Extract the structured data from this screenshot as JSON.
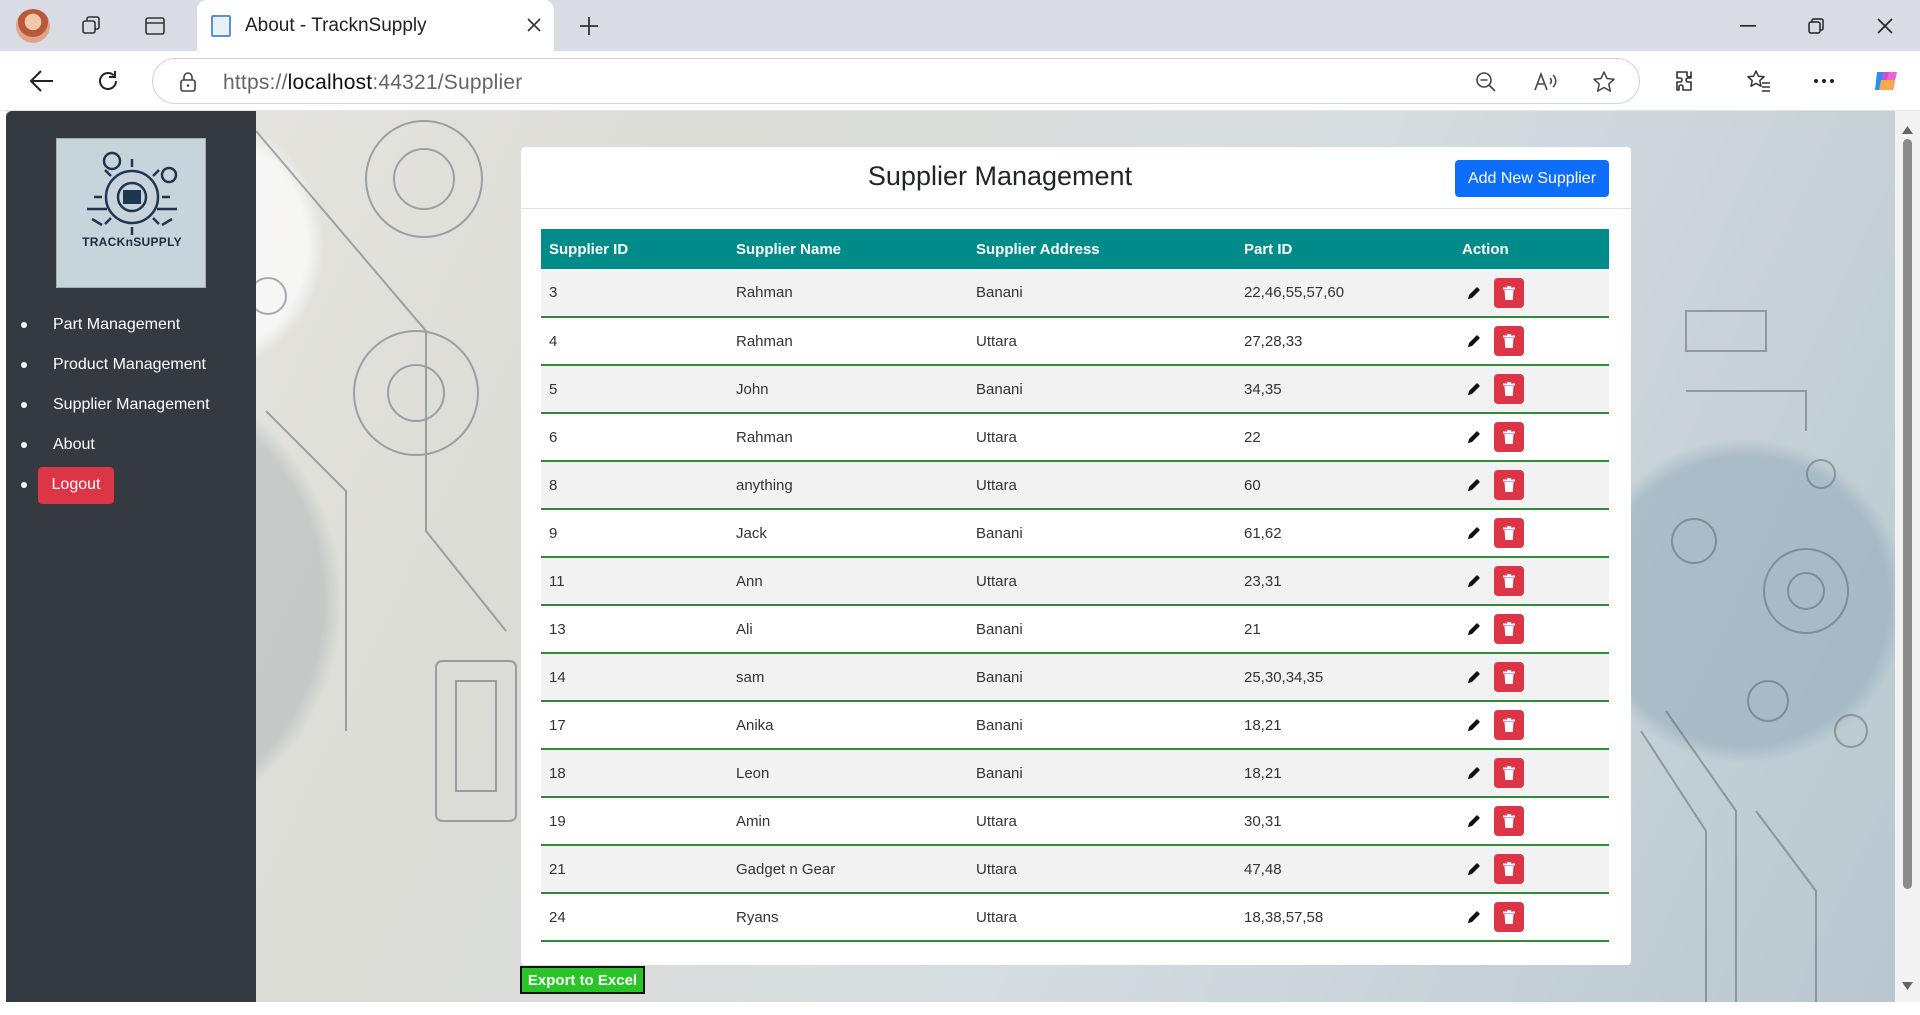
{
  "browser": {
    "tab_title": "About - TracknSupply",
    "url_scheme": "https://",
    "url_host": "localhost",
    "url_rest": ":44321/Supplier"
  },
  "sidebar": {
    "logo_text": "TRACKnSUPPLY",
    "items": [
      {
        "label": "Part Management"
      },
      {
        "label": "Product Management"
      },
      {
        "label": "Supplier Management"
      },
      {
        "label": "About"
      }
    ],
    "logout_label": "Logout"
  },
  "main": {
    "title": "Supplier Management",
    "add_button_label": "Add New Supplier",
    "export_button_label": "Export to Excel",
    "columns": [
      "Supplier ID",
      "Supplier Name",
      "Supplier Address",
      "Part ID",
      "Action"
    ],
    "rows": [
      {
        "id": "3",
        "name": "Rahman",
        "address": "Banani",
        "parts": "22,46,55,57,60"
      },
      {
        "id": "4",
        "name": "Rahman",
        "address": "Uttara",
        "parts": "27,28,33"
      },
      {
        "id": "5",
        "name": "John",
        "address": "Banani",
        "parts": "34,35"
      },
      {
        "id": "6",
        "name": "Rahman",
        "address": "Uttara",
        "parts": "22"
      },
      {
        "id": "8",
        "name": "anything",
        "address": "Uttara",
        "parts": "60"
      },
      {
        "id": "9",
        "name": "Jack",
        "address": "Banani",
        "parts": "61,62"
      },
      {
        "id": "11",
        "name": "Ann",
        "address": "Uttara",
        "parts": "23,31"
      },
      {
        "id": "13",
        "name": "Ali",
        "address": "Banani",
        "parts": "21"
      },
      {
        "id": "14",
        "name": "sam",
        "address": "Banani",
        "parts": "25,30,34,35"
      },
      {
        "id": "17",
        "name": "Anika",
        "address": "Banani",
        "parts": "18,21"
      },
      {
        "id": "18",
        "name": "Leon",
        "address": "Banani",
        "parts": "18,21"
      },
      {
        "id": "19",
        "name": "Amin",
        "address": "Uttara",
        "parts": "30,31"
      },
      {
        "id": "21",
        "name": "Gadget n Gear",
        "address": "Uttara",
        "parts": "47,48"
      },
      {
        "id": "24",
        "name": "Ryans",
        "address": "Uttara",
        "parts": "18,38,57,58"
      }
    ]
  },
  "colors": {
    "sidebar": "#343a40",
    "header_row": "#008b8b",
    "primary": "#0d6efd",
    "danger": "#dc3545",
    "export": "#28c428",
    "row_border": "#2e8b3a"
  },
  "icons": {
    "edit": "pencil-icon",
    "delete": "trash-icon"
  }
}
